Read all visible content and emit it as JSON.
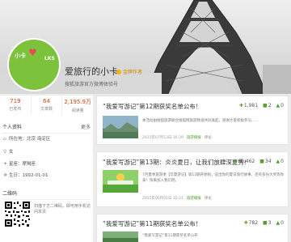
{
  "profile": {
    "name": "爱旅行的小卡",
    "badge": "金牌作者",
    "subtitle": "搜狐旅游官方微博体验号",
    "avatar_text_left": "小卡",
    "avatar_text_right": "LKS"
  },
  "stats": [
    {
      "value": "719",
      "label": "已发布"
    },
    {
      "value": "64",
      "label": "文章数"
    },
    {
      "value": "2,195.9万",
      "label": "阅读量"
    }
  ],
  "personal": {
    "title": "个人资料",
    "more": "更多",
    "rows": [
      {
        "icon": "location-icon",
        "glyph": "⌂",
        "text": "所在地：北京 海淀区"
      },
      {
        "icon": "person-icon",
        "glyph": "♀",
        "text": "女"
      },
      {
        "icon": "zodiac-icon",
        "glyph": "✦",
        "text": "星座：摩羯座"
      },
      {
        "icon": "birthday-icon",
        "glyph": "❖",
        "text": "生日：1992-01-01"
      }
    ]
  },
  "qrcode": {
    "title": "二维码",
    "text": "扫描下方二维码，即可用手机访问本页"
  },
  "feed": [
    {
      "title": "“我爱写游记”第12期获奖名单公布！",
      "likes": "1,981",
      "comments": "2",
      "shares": "0",
      "snippet": "本活动由搜狐旅游联合搜狐网旅游频道共同发起，感谢大家积极参与……",
      "date": "2015年07月13日 16:29",
      "tag": "旅游播报",
      "action": "评论"
    },
    {
      "title": "“我爱写游记”第13期：炎炎夏日，让我们放肆深夏秀！",
      "likes": "60,462",
      "comments": "34",
      "shares": "0",
      "snippet": "7月夏季旅游季【华夏游记】第13期开始啦，说出你的夏日旅行故事，还有多份大奖等你拿！快来加入我们吧。",
      "date": "2015年06月01日 10:21",
      "tag": "旅游播报",
      "action": "评论"
    },
    {
      "title": "“我爱写游记”第11期获奖名单公布！",
      "likes": "782",
      "comments": "3",
      "shares": "0",
      "snippet": "“我爱写游记”第11期获奖名单公布",
      "date": "",
      "tag": "",
      "action": ""
    }
  ],
  "colors": {
    "accent": "#d0451b",
    "green": "#5a9c2d",
    "avatar": "#7cc23a"
  }
}
